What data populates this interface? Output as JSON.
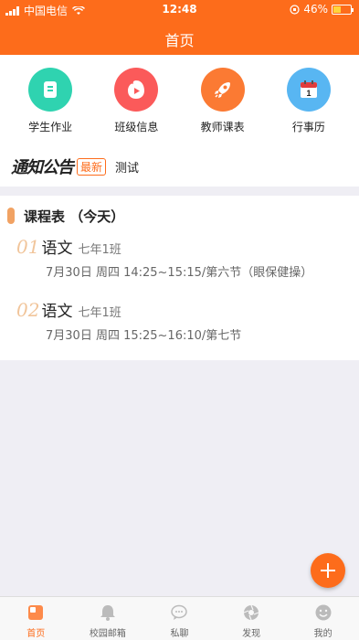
{
  "status_bar": {
    "carrier": "中国电信",
    "time": "12:48",
    "battery": "46%",
    "battery_level": 0.46
  },
  "header": {
    "title": "首页"
  },
  "quick_actions": [
    {
      "label": "学生作业",
      "icon": "homework-icon",
      "color": "#2fd3b0"
    },
    {
      "label": "班级信息",
      "icon": "class-info-icon",
      "color": "#fb5a5a"
    },
    {
      "label": "教师课表",
      "icon": "rocket-icon",
      "color": "#fb7a33"
    },
    {
      "label": "行事历",
      "icon": "calendar-icon",
      "color": "#58b6f2"
    }
  ],
  "notice": {
    "logo_text": "通知公告",
    "badge": "最新",
    "text": "测试"
  },
  "schedule": {
    "title": "课程表 （今天）",
    "lessons": [
      {
        "number": "01",
        "subject": "语文",
        "class": "七年1班",
        "detail": "7月30日 周四 14:25~15:15/第六节（眼保健操）"
      },
      {
        "number": "02",
        "subject": "语文",
        "class": "七年1班",
        "detail": "7月30日 周四 15:25~16:10/第七节"
      }
    ]
  },
  "tabs": [
    {
      "label": "首页",
      "icon": "home-icon",
      "active": true
    },
    {
      "label": "校园邮箱",
      "icon": "bell-icon",
      "active": false
    },
    {
      "label": "私聊",
      "icon": "chat-icon",
      "active": false
    },
    {
      "label": "发现",
      "icon": "discover-icon",
      "active": false
    },
    {
      "label": "我的",
      "icon": "profile-icon",
      "active": false
    }
  ],
  "colors": {
    "accent": "#fd6c1b",
    "background": "#efeef4"
  }
}
